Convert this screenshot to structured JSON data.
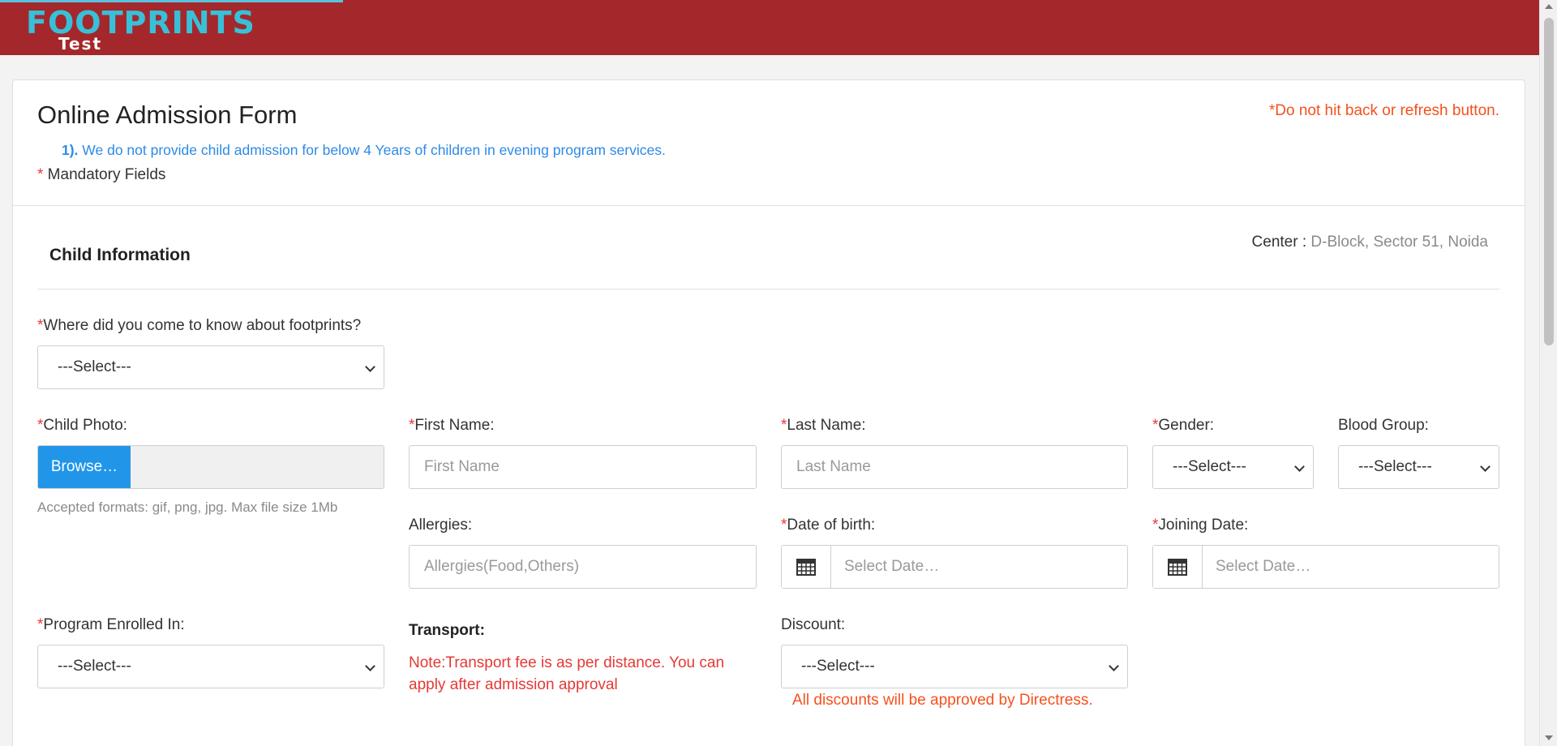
{
  "header": {
    "logo_main": "FOOTPRINTS",
    "logo_sub": "Test"
  },
  "form": {
    "title": "Online Admission Form",
    "warning": "*Do not hit back or refresh button.",
    "notice_number": "1).",
    "notice_text": " We do not provide child admission for below 4 Years of children in evening program services.",
    "mandatory_star": "*",
    "mandatory_text": " Mandatory Fields"
  },
  "section": {
    "title": "Child Information",
    "center_label": "Center :",
    "center_value": " D-Block, Sector 51, Noida"
  },
  "fields": {
    "source": {
      "label": "Where did you come to know about footprints?",
      "value": "---Select---"
    },
    "photo": {
      "label": "Child Photo:",
      "button": "Browse…",
      "help": "Accepted formats: gif, png, jpg. Max file size 1Mb"
    },
    "first_name": {
      "label": "First Name:",
      "placeholder": "First Name"
    },
    "last_name": {
      "label": "Last Name:",
      "placeholder": "Last Name"
    },
    "gender": {
      "label": "Gender:",
      "value": "---Select---"
    },
    "blood_group": {
      "label": "Blood Group:",
      "value": "---Select---"
    },
    "allergies": {
      "label": "Allergies:",
      "placeholder": "Allergies(Food,Others)"
    },
    "dob": {
      "label": "Date of birth:",
      "placeholder": "Select Date…"
    },
    "joining": {
      "label": "Joining Date:",
      "placeholder": "Select Date…"
    },
    "program": {
      "label": "Program Enrolled In:",
      "value": "---Select---"
    },
    "transport": {
      "label": "Transport:",
      "note": "Note:Transport fee is as per distance. You can apply after admission approval"
    },
    "discount": {
      "label": "Discount:",
      "value": "---Select---",
      "note": "All discounts will be approved by Directress."
    }
  },
  "required_mark": "*",
  "colors": {
    "header_bg": "#a4282b",
    "logo": "#38c0d8",
    "primary": "#2196e8",
    "required": "#e53935",
    "warning": "#f4511e"
  },
  "icons": [
    "calendar-icon",
    "chevron-down-icon"
  ]
}
